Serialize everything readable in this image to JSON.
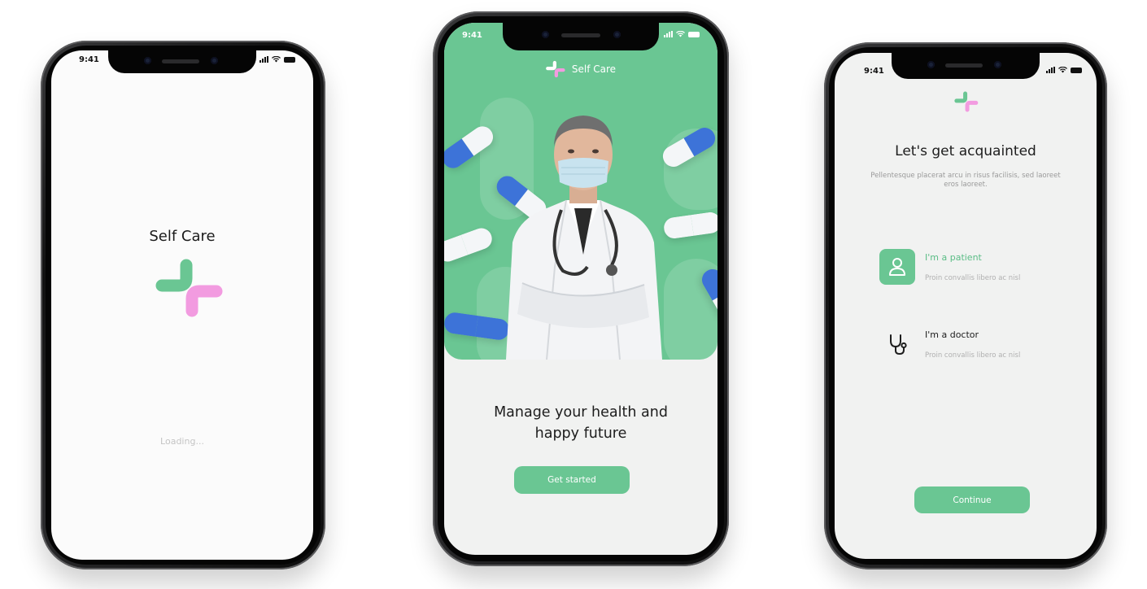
{
  "colors": {
    "accent_green": "#6ac693",
    "accent_pink": "#f29be0",
    "pill_blue": "#3d73d8"
  },
  "status_bar": {
    "time": "9:41"
  },
  "splash": {
    "title": "Self Care",
    "loading_text": "Loading...",
    "logo_icon": "self-care-logo-icon"
  },
  "onboarding": {
    "brand": "Self Care",
    "heading_line1": "Manage your health and",
    "heading_line2": "happy future",
    "cta": "Get started"
  },
  "role_select": {
    "title": "Let's get acquainted",
    "subtitle": "Pellentesque placerat arcu in risus facilisis, sed laoreet eros laoreet.",
    "options": [
      {
        "title": "I'm a patient",
        "subtitle": "Proin convallis libero ac nisl",
        "icon": "user-icon",
        "selected": true
      },
      {
        "title": "I'm a doctor",
        "subtitle": "Proin convallis libero ac nisl",
        "icon": "stethoscope-icon",
        "selected": false
      }
    ],
    "cta": "Continue"
  }
}
